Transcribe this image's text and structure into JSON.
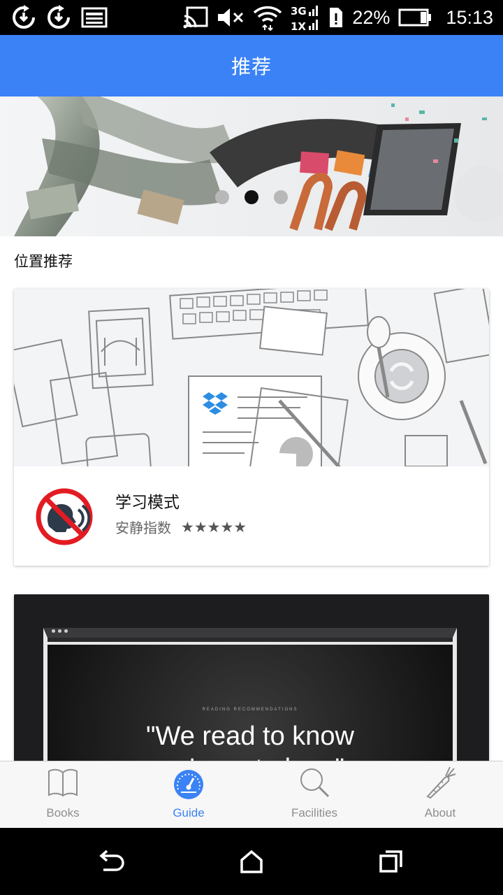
{
  "status_bar": {
    "battery_percent": "22%",
    "time": "15:13",
    "network_3g": "3G",
    "network_1x": "1X"
  },
  "app_bar": {
    "title": "推荐"
  },
  "carousel": {
    "slide_count": 3,
    "active_index": 1
  },
  "section": {
    "title": "位置推荐"
  },
  "cards": [
    {
      "title": "学习模式",
      "rating_label": "安静指数",
      "rating_stars": "★★★★★",
      "rating_value": 5
    },
    {
      "image_caption": "READING RECOMMENDATIONS",
      "image_quote_line1": "\"We read to know",
      "image_quote_line2": "we're not alone\""
    }
  ],
  "bottom_nav": {
    "active": "Guide",
    "items": [
      {
        "label": "Books",
        "icon": "book-icon"
      },
      {
        "label": "Guide",
        "icon": "speedometer-icon"
      },
      {
        "label": "Facilities",
        "icon": "search-icon"
      },
      {
        "label": "About",
        "icon": "carrot-icon"
      }
    ]
  },
  "colors": {
    "accent": "#3a82f6",
    "inactive": "#8e8e8e"
  }
}
